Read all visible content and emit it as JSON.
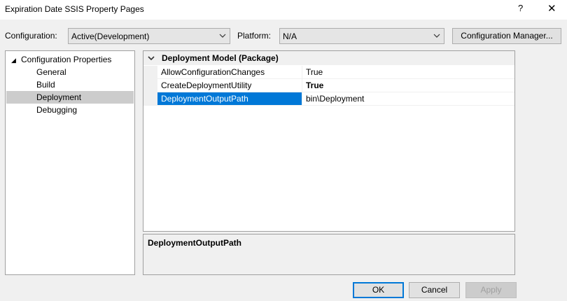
{
  "window": {
    "title": "Expiration Date SSIS Property Pages",
    "help_glyph": "?",
    "close_glyph": "✕"
  },
  "toolbar": {
    "configuration_label": "Configuration:",
    "configuration_value": "Active(Development)",
    "platform_label": "Platform:",
    "platform_value": "N/A",
    "config_manager_label": "Configuration Manager..."
  },
  "tree": {
    "root_label": "Configuration Properties",
    "items": [
      {
        "label": "General"
      },
      {
        "label": "Build"
      },
      {
        "label": "Deployment",
        "selected": true
      },
      {
        "label": "Debugging"
      }
    ]
  },
  "grid": {
    "category": "Deployment Model (Package)",
    "rows": [
      {
        "name": "AllowConfigurationChanges",
        "value": "True"
      },
      {
        "name": "CreateDeploymentUtility",
        "value": "True"
      },
      {
        "name": "DeploymentOutputPath",
        "value": "bin\\Deployment"
      }
    ]
  },
  "description": {
    "title": "DeploymentOutputPath"
  },
  "buttons": {
    "ok": "OK",
    "cancel": "Cancel",
    "apply": "Apply"
  },
  "colors": {
    "selection": "#0078d7",
    "tree_selection": "#cccccc",
    "window_bg": "#f0f0f0"
  }
}
